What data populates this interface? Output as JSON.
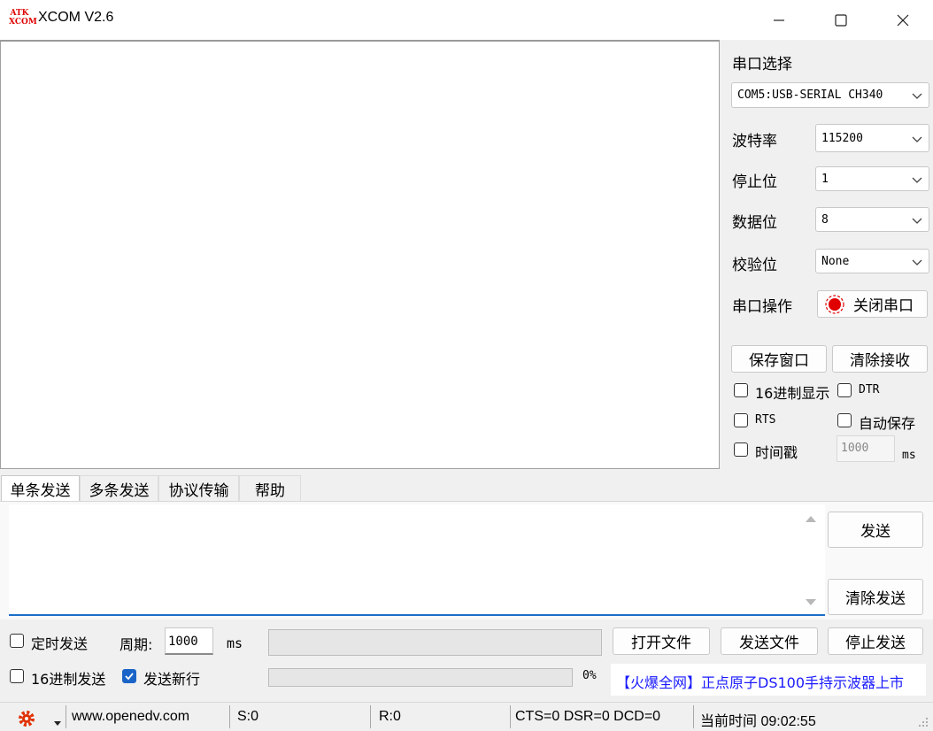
{
  "window": {
    "logo_text": "ATK XCOM",
    "title": "XCOM V2.6"
  },
  "port": {
    "label": "串口选择",
    "value": "COM5:USB-SERIAL CH340"
  },
  "baud": {
    "label": "波特率",
    "value": "115200"
  },
  "stopbits": {
    "label": "停止位",
    "value": "1"
  },
  "databits": {
    "label": "数据位",
    "value": "8"
  },
  "parity": {
    "label": "校验位",
    "value": "None"
  },
  "operation": {
    "label": "串口操作",
    "button": "关闭串口",
    "indicator_color": "#e00000"
  },
  "actions": {
    "save_window": "保存窗口",
    "clear_receive": "清除接收"
  },
  "options": {
    "hex_display": "16进制显示",
    "dtr": "DTR",
    "rts": "RTS",
    "auto_save": "自动保存",
    "timestamp": "时间戳",
    "timestamp_value": "1000",
    "timestamp_unit": "ms"
  },
  "tabs": [
    "单条发送",
    "多条发送",
    "协议传输",
    "帮助"
  ],
  "send": {
    "send_button": "发送",
    "clear_send_button": "清除发送",
    "timed_send": "定时发送",
    "period_label": "周期:",
    "period_value": "1000",
    "period_unit": "ms",
    "open_file": "打开文件",
    "send_file": "发送文件",
    "stop_send": "停止发送",
    "hex_send": "16进制发送",
    "send_newline": "发送新行",
    "send_newline_checked": true,
    "progress_percent": "0%",
    "promo": "【火爆全网】正点原子DS100手持示波器上市"
  },
  "status": {
    "url": "www.openedv.com",
    "sent": "S:0",
    "received": "R:0",
    "lines": "CTS=0 DSR=0 DCD=0",
    "time": "当前时间 09:02:55"
  },
  "colors": {
    "accent": "#1a64c8",
    "promo": "#1a1aff",
    "gear": "#e03000"
  }
}
